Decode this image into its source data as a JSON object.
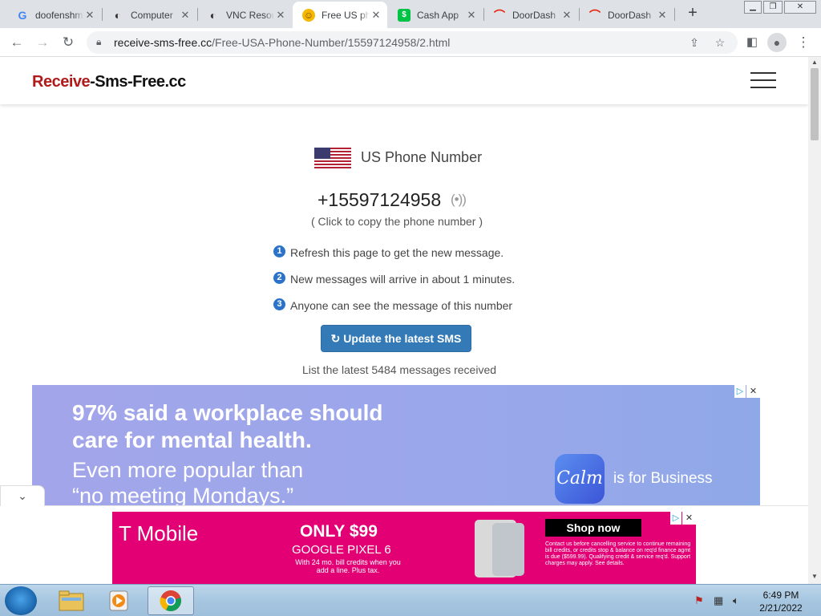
{
  "browser": {
    "tabs": [
      {
        "title": "doofenshmirtz",
        "favicon": "google-icon",
        "color": "#4285f4",
        "glyph": "G"
      },
      {
        "title": "Computer",
        "favicon": "cow-icon",
        "color": "#444444",
        "glyph": "◐"
      },
      {
        "title": "VNC Resources",
        "favicon": "cow-icon",
        "color": "#444444",
        "glyph": "◐"
      },
      {
        "title": "Free US phone",
        "favicon": "smiley-icon",
        "color": "#f5b700",
        "glyph": "☺"
      },
      {
        "title": "Cash App",
        "favicon": "cashapp-icon",
        "color": "#00c244",
        "glyph": "$"
      },
      {
        "title": "DoorDash",
        "favicon": "doordash-icon",
        "color": "#eb1700",
        "glyph": "⌒"
      },
      {
        "title": "DoorDash",
        "favicon": "doordash-icon",
        "color": "#eb1700",
        "glyph": "⌒"
      }
    ],
    "active_tab_index": 3,
    "url_host": "receive-sms-free.cc",
    "url_path": "/Free-USA-Phone-Number/15597124958/2.html"
  },
  "site": {
    "logo_part1": "Receive",
    "logo_part2": "-Sms-Free.cc"
  },
  "main": {
    "country_label": "US Phone Number",
    "phone_number": "+15597124958",
    "signal_glyph": "(•))",
    "copy_hint": "( Click to copy the phone number )",
    "steps": [
      {
        "num": "1",
        "text": "Refresh this page to get the new message."
      },
      {
        "num": "2",
        "text": "New messages will arrive in about 1 minutes."
      },
      {
        "num": "3",
        "text": "Anyone can see the message of this number"
      }
    ],
    "update_button": "↻ Update the latest SMS",
    "list_note": "List the latest 5484 messages received"
  },
  "ads": {
    "calm": {
      "headline1": "97% said a workplace should",
      "headline2": "care for mental health.",
      "sub1": "Even more popular than",
      "sub2": "“no meeting Mondays.”",
      "brand": "Calm",
      "brand_suffix": "is for Business"
    },
    "tmobile": {
      "brand": "T Mobile",
      "offer": "ONLY $99",
      "product": "GOOGLE PIXEL 6",
      "fine1": "With 24 mo. bill credits when you add a line. Plus tax.",
      "cta": "Shop now",
      "fine2": "Contact us before cancelling service to continue remaining bill credits, or credits stop & balance on req'd finance agmt is due ($599.99). Qualifying credit & service req'd. Support charges may apply. See details."
    }
  },
  "taskbar": {
    "time": "6:49 PM",
    "date": "2/21/2022"
  },
  "colors": {
    "logo_red": "#b11a1a",
    "button_blue": "#337ab7",
    "tmobile_magenta": "#e20074"
  }
}
